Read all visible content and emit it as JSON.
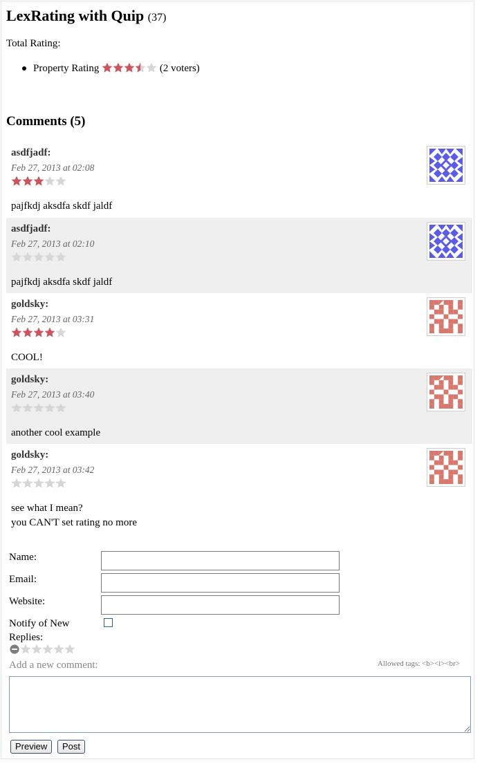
{
  "page": {
    "title": "LexRating with Quip",
    "title_count": "(37)"
  },
  "total_rating": {
    "label": "Total Rating:",
    "items": [
      {
        "name": "Property Rating",
        "stars": 3.5,
        "max": 5,
        "voters": "(2 voters)"
      }
    ]
  },
  "comments_section": {
    "title": "Comments (5)",
    "items": [
      {
        "author": "asdfjadf:",
        "date": "Feb 27, 2013 at 02:08",
        "rating": 3,
        "text": [
          "pajfkdj aksdfa skdf jaldf"
        ],
        "avatar": "blue-identicon",
        "alt": false
      },
      {
        "author": "asdfjadf:",
        "date": "Feb 27, 2013 at 02:10",
        "rating": 0,
        "text": [
          "pajfkdj aksdfa skdf jaldf"
        ],
        "avatar": "blue-identicon",
        "alt": true
      },
      {
        "author": "goldsky:",
        "date": "Feb 27, 2013 at 03:31",
        "rating": 4,
        "text": [
          "COOL!"
        ],
        "avatar": "salmon-identicon",
        "alt": false
      },
      {
        "author": "goldsky:",
        "date": "Feb 27, 2013 at 03:40",
        "rating": 0,
        "text": [
          "another cool example"
        ],
        "avatar": "salmon-identicon",
        "alt": true
      },
      {
        "author": "goldsky:",
        "date": "Feb 27, 2013 at 03:42",
        "rating": 0,
        "text": [
          "see what I mean?",
          "you CAN'T set rating no more"
        ],
        "avatar": "salmon-identicon",
        "alt": false
      }
    ]
  },
  "form": {
    "name_label": "Name:",
    "name_value": "",
    "email_label": "Email:",
    "email_value": "",
    "website_label": "Website:",
    "website_value": "",
    "notify_label_line1": "Notify of New",
    "notify_label_line2": "Replies:",
    "notify_checked": false,
    "new_rating": 0,
    "add_comment_label": "Add a new comment:",
    "allowed_tags": "Allowed tags: <b><i><br>",
    "comment_value": "",
    "preview_button": "Preview",
    "post_button": "Post"
  },
  "colors": {
    "star_filled": "#c9555e",
    "star_empty": "#d6d6d6",
    "avatar_blue": "#5b5be6",
    "avatar_salmon": "#d6786d",
    "alt_row_bg": "#efefef",
    "cancel_icon": "#7d7d7d"
  }
}
